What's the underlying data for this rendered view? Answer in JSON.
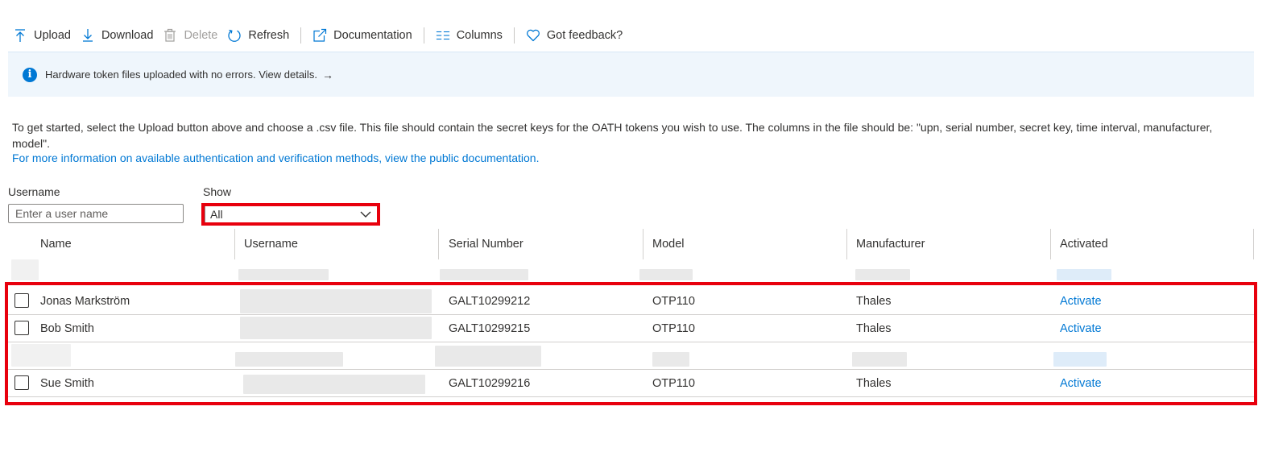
{
  "toolbar": {
    "upload": "Upload",
    "download": "Download",
    "delete": "Delete",
    "refresh": "Refresh",
    "documentation": "Documentation",
    "columns": "Columns",
    "feedback": "Got feedback?"
  },
  "banner": {
    "icon": "info-icon",
    "text": "Hardware token files uploaded with no errors. View details.",
    "arrow": "→"
  },
  "intro": {
    "text": "To get started, select the Upload button above and choose a .csv file. This file should contain the secret keys for the OATH tokens you wish to use. The columns in the file should be: \"upn, serial number, secret key, time interval, manufacturer, model\".",
    "link": "For more information on available authentication and verification methods, view the public documentation."
  },
  "filters": {
    "username_label": "Username",
    "username_placeholder": "Enter a user name",
    "show_label": "Show",
    "show_value": "All"
  },
  "table": {
    "headers": [
      "Name",
      "Username",
      "Serial Number",
      "Model",
      "Manufacturer",
      "Activated"
    ],
    "rows": [
      {
        "name": "Jonas Markström",
        "serial": "GALT10299212",
        "model": "OTP110",
        "manufacturer": "Thales",
        "activated": "Activate"
      },
      {
        "name": "Bob Smith",
        "serial": "GALT10299215",
        "model": "OTP110",
        "manufacturer": "Thales",
        "activated": "Activate"
      },
      {
        "name": "Sue Smith",
        "serial": "GALT10299216",
        "model": "OTP110",
        "manufacturer": "Thales",
        "activated": "Activate"
      }
    ]
  },
  "colors": {
    "accent": "#0078d4",
    "highlight": "#e8000d",
    "banner_bg": "#eff6fc"
  }
}
